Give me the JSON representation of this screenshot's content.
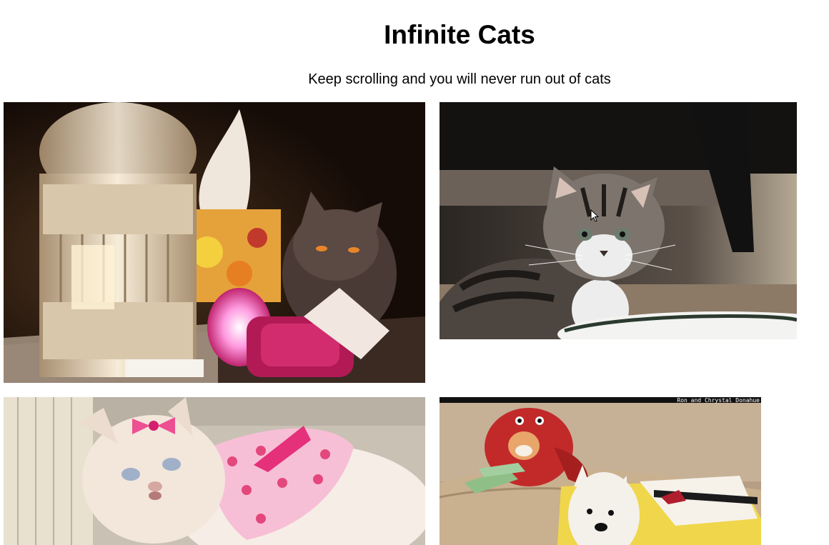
{
  "header": {
    "title": "Infinite Cats",
    "subtitle": "Keep scrolling and you will never run out of cats"
  },
  "feed": {
    "photos": [
      {
        "subject": "gray cat beside a lit birdcage lantern and tissue box"
      },
      {
        "subject": "tabby kitten looking at camera next to a white bowl"
      },
      {
        "subject": "white persian cat with pink bow and dress"
      },
      {
        "subject": "cat in red lobster costume with a westie dog",
        "watermark": "Ron and Chrystal Donahue"
      }
    ]
  },
  "colors": {
    "background": "#ffffff",
    "text": "#000000"
  }
}
